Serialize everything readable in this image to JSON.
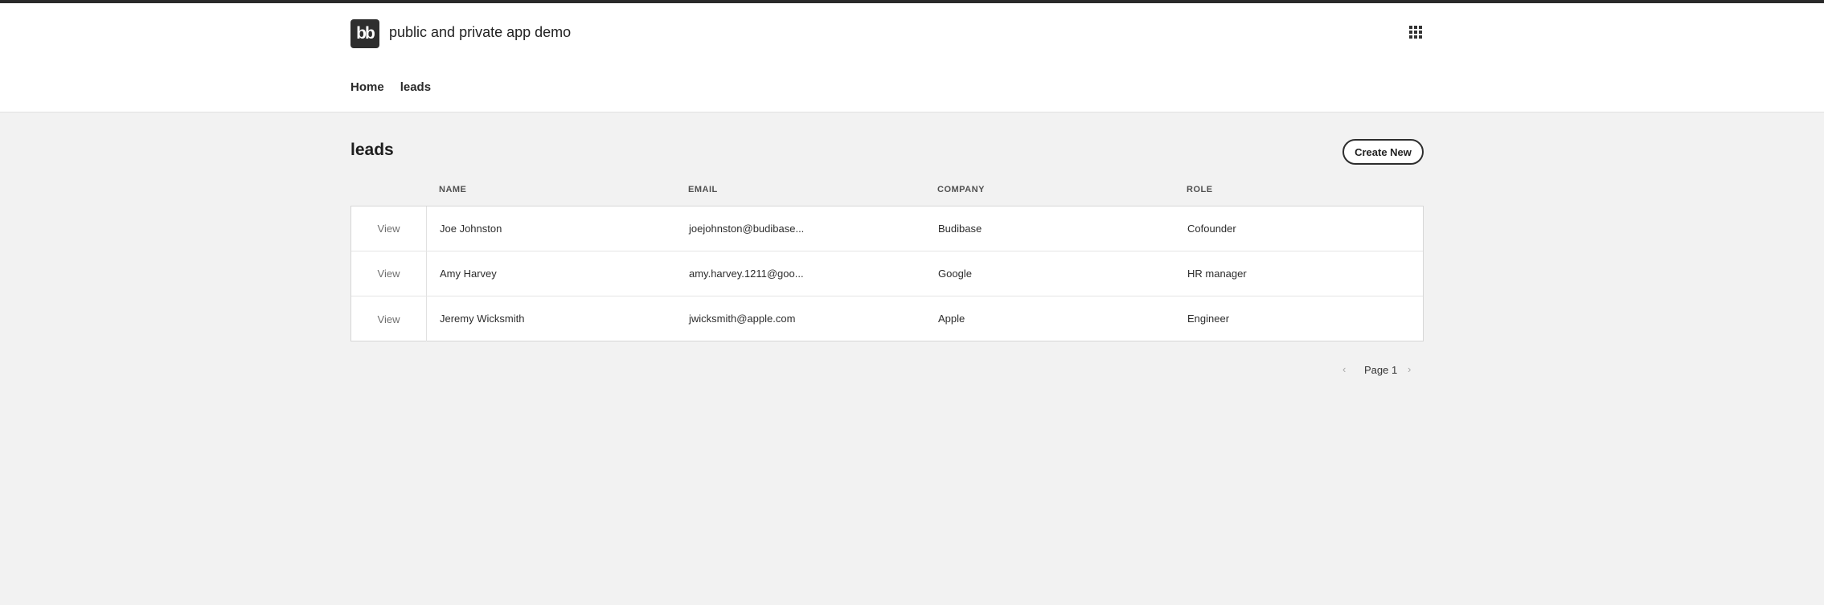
{
  "app": {
    "logo_text": "bb",
    "title": "public and private app demo"
  },
  "nav": {
    "items": [
      "Home",
      "leads"
    ]
  },
  "page": {
    "title": "leads",
    "create_button": "Create New"
  },
  "table": {
    "columns": [
      "NAME",
      "EMAIL",
      "COMPANY",
      "ROLE"
    ],
    "view_label": "View",
    "rows": [
      {
        "name": "Joe Johnston",
        "email": "joejohnston@budibase...",
        "company": "Budibase",
        "role": "Cofounder"
      },
      {
        "name": "Amy Harvey",
        "email": "amy.harvey.1211@goo...",
        "company": "Google",
        "role": "HR manager"
      },
      {
        "name": "Jeremy Wicksmith",
        "email": "jwicksmith@apple.com",
        "company": "Apple",
        "role": "Engineer"
      }
    ]
  },
  "pagination": {
    "label": "Page 1",
    "prev_icon": "‹",
    "next_icon": "›"
  },
  "icons": {
    "apps": "grid-icon"
  }
}
